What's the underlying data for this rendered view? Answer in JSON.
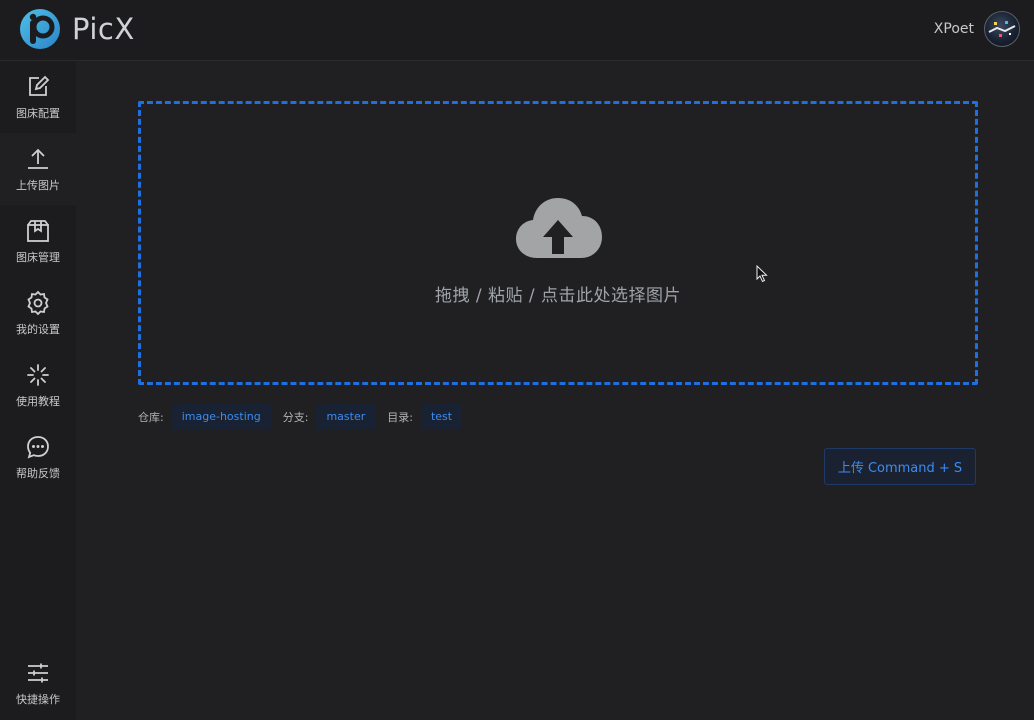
{
  "app": {
    "name": "PicX",
    "user_name": "XPoet"
  },
  "sidebar": {
    "items": [
      {
        "label": "图床配置",
        "icon": "edit-icon"
      },
      {
        "label": "上传图片",
        "icon": "upload-icon"
      },
      {
        "label": "图床管理",
        "icon": "box-icon"
      },
      {
        "label": "我的设置",
        "icon": "gear-icon"
      },
      {
        "label": "使用教程",
        "icon": "loading-spinner-icon"
      },
      {
        "label": "帮助反馈",
        "icon": "chat-bubble-icon"
      }
    ],
    "bottom_item": {
      "label": "快捷操作",
      "icon": "sliders-icon"
    },
    "active_index": 1
  },
  "upload": {
    "drop_text": "拖拽 / 粘贴 / 点击此处选择图片",
    "repo_label": "仓库:",
    "repo_value": "image-hosting",
    "branch_label": "分支:",
    "branch_value": "master",
    "dir_label": "目录:",
    "dir_value": "test",
    "upload_button": "上传 Command + S"
  },
  "colors": {
    "accent": "#1e6fe0",
    "tag_text": "#3d8bf0",
    "tag_bg": "#192233",
    "background": "#202022",
    "sidebar_bg": "#1c1c1e"
  }
}
